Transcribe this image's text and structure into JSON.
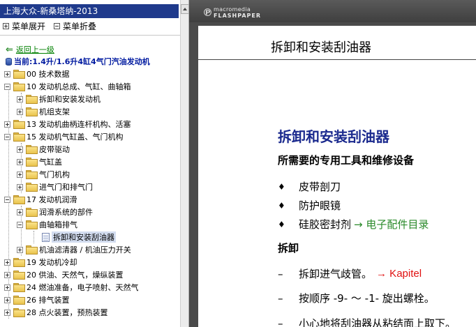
{
  "nav": {
    "title": "上海大众-新桑塔纳-2013",
    "expand_label": "菜单展开",
    "collapse_label": "菜单折叠",
    "back_label": "返回上一级",
    "current_label": "当前:1.4升/1.6升4缸4气门汽油发动机"
  },
  "tree": [
    {
      "label": "00 技术数据"
    },
    {
      "label": "10 发动机总成、气缸、曲轴箱"
    },
    {
      "label": "拆卸和安装发动机"
    },
    {
      "label": "机组支架"
    },
    {
      "label": "13 发动机曲柄连杆机构、活塞"
    },
    {
      "label": "15 发动机气缸盖、气门机构"
    },
    {
      "label": "皮带驱动"
    },
    {
      "label": "气缸盖"
    },
    {
      "label": "气门机构"
    },
    {
      "label": "进气门和排气门"
    },
    {
      "label": "17 发动机润滑"
    },
    {
      "label": "润滑系统的部件"
    },
    {
      "label": "曲轴箱排气"
    },
    {
      "label": "拆卸和安装刮油器"
    },
    {
      "label": "机油滤清器 / 机油压力开关"
    },
    {
      "label": "19 发动机冷却"
    },
    {
      "label": "20 供油、天然气，燥纵装置"
    },
    {
      "label": "24 燃油准备，电子喷射、天然气"
    },
    {
      "label": "26 排气装置"
    },
    {
      "label": "28 点火装置，预热装置"
    }
  ],
  "viewer": {
    "brand_small": "macromedia",
    "brand_big": "FLASHPAPER",
    "doc_header": "拆卸和安装刮油器",
    "heading": "拆卸和安装刮油器",
    "tools_heading": "所需要的专用工具和维修设备",
    "tools": [
      {
        "bullet": "♦",
        "text": "皮带剖刀",
        "link": ""
      },
      {
        "bullet": "♦",
        "text": "防护眼镜",
        "link": ""
      },
      {
        "bullet": "♦",
        "text": "硅胶密封剂",
        "link": "→ 电子配件目录"
      }
    ],
    "removal_heading": "拆卸",
    "steps": [
      {
        "dash": "–",
        "text": "拆卸进气歧管。",
        "link": "→ Kapitel"
      },
      {
        "dash": "–",
        "text": "按顺序 -9- ～ -1- 旋出螺栓。",
        "link": ""
      },
      {
        "dash": "–",
        "text": "小心地将刮油器从粘结面上取下。",
        "link": ""
      }
    ]
  }
}
